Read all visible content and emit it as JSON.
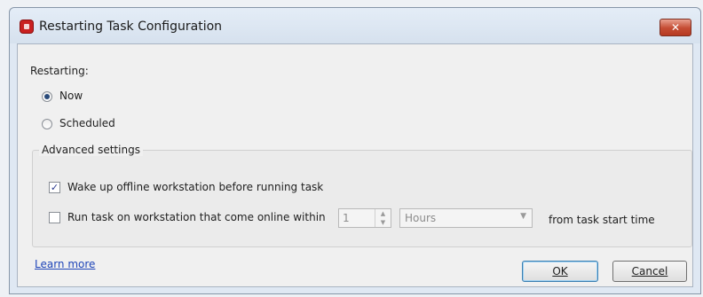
{
  "window": {
    "title": "Restarting Task Configuration",
    "close_glyph": "✕"
  },
  "restarting": {
    "label": "Restarting:",
    "options": [
      {
        "label": "Now",
        "selected": true
      },
      {
        "label": "Scheduled",
        "selected": false
      }
    ]
  },
  "advanced": {
    "title": "Advanced settings",
    "wake_up": {
      "label": "Wake up offline workstation before running task",
      "checked": true
    },
    "run_task": {
      "label": "Run task on workstation that come online within",
      "checked": false,
      "amount": "1",
      "unit": "Hours",
      "suffix": "from task start time"
    }
  },
  "footer": {
    "learn_more": "Learn more",
    "ok_label": "OK",
    "cancel_label": "Cancel"
  },
  "icons": {
    "app": "app-icon",
    "close": "close-icon",
    "check": "✓",
    "spin_up": "▲",
    "spin_down": "▼",
    "dropdown": "▼"
  },
  "colors": {
    "link": "#1f45b8",
    "close": "#c44b32",
    "accent": "#3c7fb1"
  }
}
